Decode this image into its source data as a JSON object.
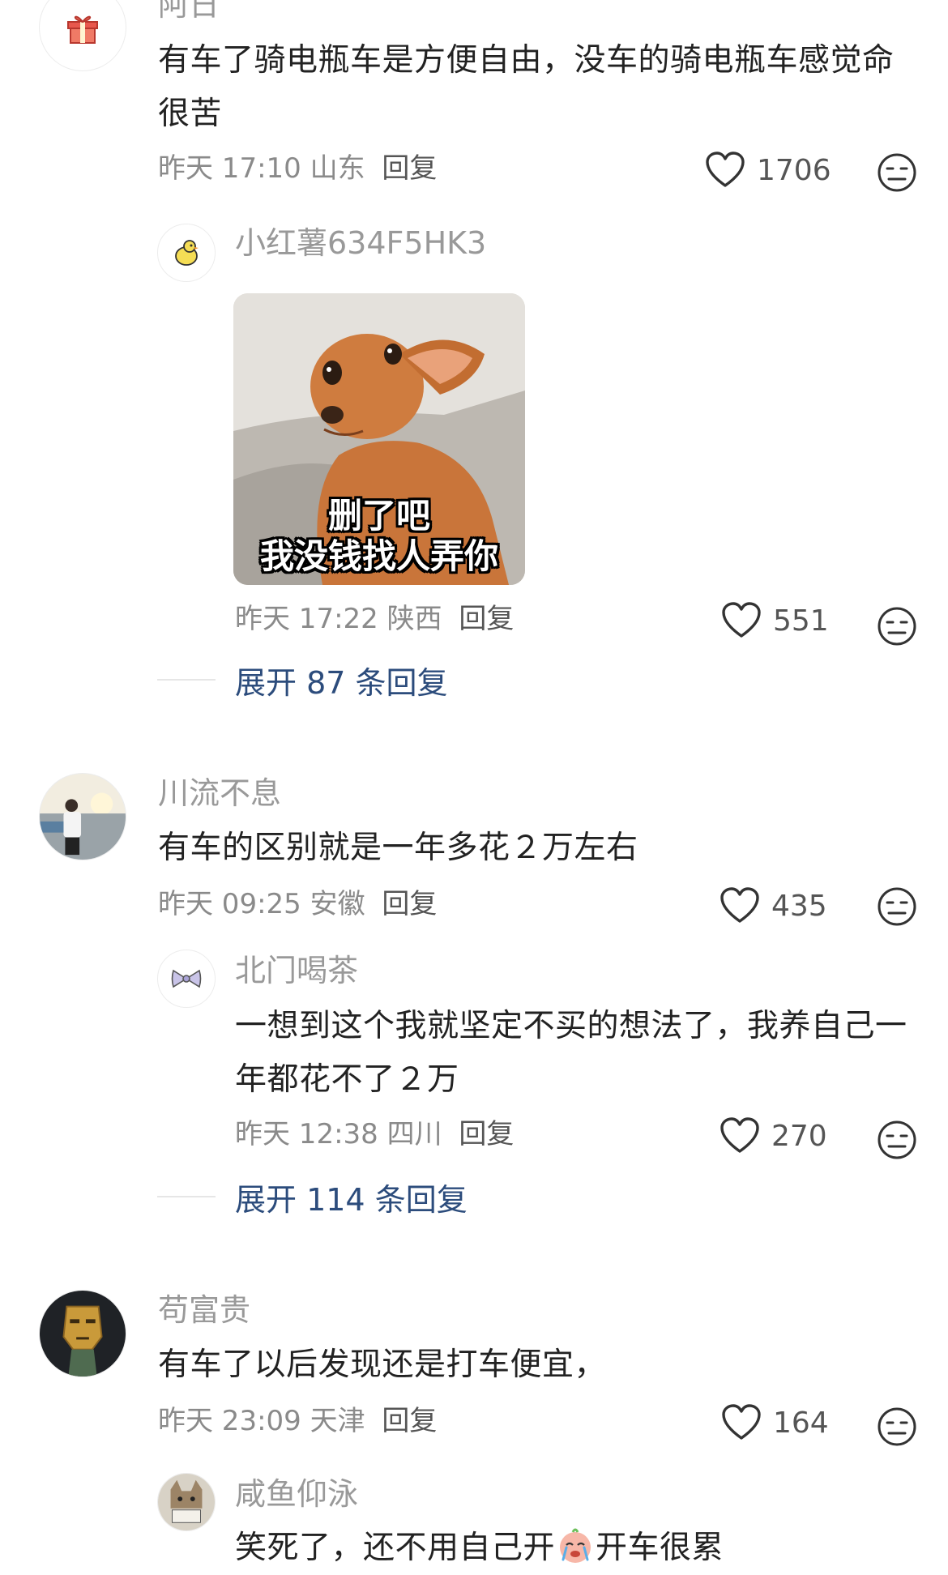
{
  "comments": [
    {
      "user": "阿日",
      "text": "有车了骑电瓶车是方便自由，没车的骑电瓶车感觉命很苦",
      "time": "昨天 17:10",
      "location": "山东",
      "reply_label": "回复",
      "likes": "1706",
      "avatar_icon": "gift-icon"
    },
    {
      "user": "川流不息",
      "text": "有车的区别就是一年多花２万左右",
      "time": "昨天 09:25",
      "location": "安徽",
      "reply_label": "回复",
      "likes": "435",
      "avatar_icon": "photo-avatar"
    },
    {
      "user": "苟富贵",
      "text": "有车了以后发现还是打车便宜，",
      "time": "昨天 23:09",
      "location": "天津",
      "reply_label": "回复",
      "likes": "164",
      "avatar_icon": "bronze-mask-avatar"
    }
  ],
  "replies": [
    {
      "user": "小红薯634F5HK3",
      "sticker_caption_1": "删了吧",
      "sticker_caption_2": "我没钱找人弄你",
      "time": "昨天 17:22",
      "location": "陕西",
      "reply_label": "回复",
      "likes": "551",
      "avatar_icon": "chick-icon"
    },
    {
      "user": "北门喝茶",
      "text": "一想到这个我就坚定不买的想法了，我养自己一年都花不了２万",
      "time": "昨天 12:38",
      "location": "四川",
      "reply_label": "回复",
      "likes": "270",
      "avatar_icon": "bow-icon"
    },
    {
      "user": "咸鱼仰泳",
      "text_before_emoji": "笑死了，还不用自己开",
      "text_after_emoji": "开车很累",
      "avatar_icon": "cat-avatar"
    }
  ],
  "expand_links": [
    "展开 87 条回复",
    "展开 114 条回复"
  ],
  "colors": {
    "text": "#222222",
    "name": "#999999",
    "meta": "#8a8a8a",
    "link": "#2c4c7c"
  }
}
